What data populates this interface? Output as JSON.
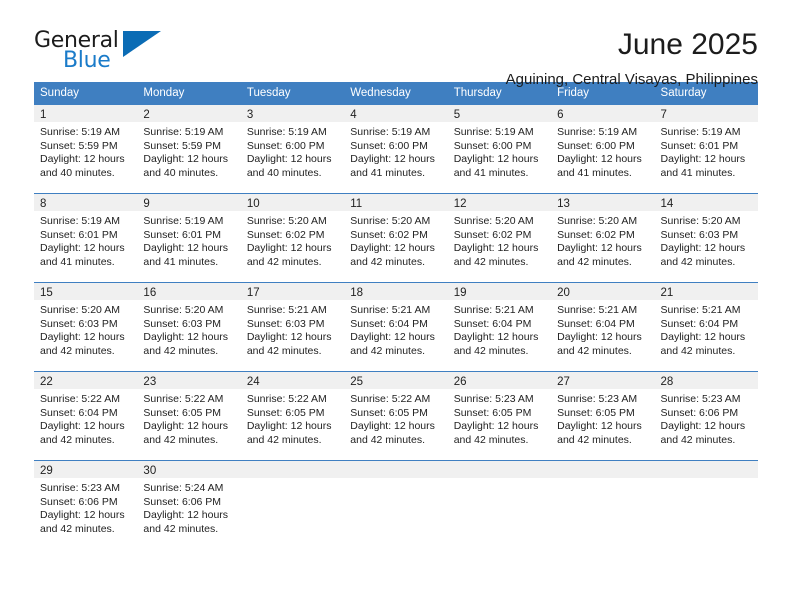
{
  "brand": {
    "name_part1": "General",
    "name_part2": "Blue",
    "logo_icon": "triangle-logo-icon"
  },
  "header": {
    "month_title": "June 2025",
    "location": "Aguining, Central Visayas, Philippines"
  },
  "theme": {
    "accent": "#3f7fc1",
    "brand_blue": "#1a7bc9",
    "daynum_band": "#f0f0f0",
    "text": "#222222"
  },
  "weekdays": [
    "Sunday",
    "Monday",
    "Tuesday",
    "Wednesday",
    "Thursday",
    "Friday",
    "Saturday"
  ],
  "weeks": [
    [
      {
        "day": "1",
        "sunrise": "Sunrise: 5:19 AM",
        "sunset": "Sunset: 5:59 PM",
        "daylight1": "Daylight: 12 hours",
        "daylight2": "and 40 minutes."
      },
      {
        "day": "2",
        "sunrise": "Sunrise: 5:19 AM",
        "sunset": "Sunset: 5:59 PM",
        "daylight1": "Daylight: 12 hours",
        "daylight2": "and 40 minutes."
      },
      {
        "day": "3",
        "sunrise": "Sunrise: 5:19 AM",
        "sunset": "Sunset: 6:00 PM",
        "daylight1": "Daylight: 12 hours",
        "daylight2": "and 40 minutes."
      },
      {
        "day": "4",
        "sunrise": "Sunrise: 5:19 AM",
        "sunset": "Sunset: 6:00 PM",
        "daylight1": "Daylight: 12 hours",
        "daylight2": "and 41 minutes."
      },
      {
        "day": "5",
        "sunrise": "Sunrise: 5:19 AM",
        "sunset": "Sunset: 6:00 PM",
        "daylight1": "Daylight: 12 hours",
        "daylight2": "and 41 minutes."
      },
      {
        "day": "6",
        "sunrise": "Sunrise: 5:19 AM",
        "sunset": "Sunset: 6:00 PM",
        "daylight1": "Daylight: 12 hours",
        "daylight2": "and 41 minutes."
      },
      {
        "day": "7",
        "sunrise": "Sunrise: 5:19 AM",
        "sunset": "Sunset: 6:01 PM",
        "daylight1": "Daylight: 12 hours",
        "daylight2": "and 41 minutes."
      }
    ],
    [
      {
        "day": "8",
        "sunrise": "Sunrise: 5:19 AM",
        "sunset": "Sunset: 6:01 PM",
        "daylight1": "Daylight: 12 hours",
        "daylight2": "and 41 minutes."
      },
      {
        "day": "9",
        "sunrise": "Sunrise: 5:19 AM",
        "sunset": "Sunset: 6:01 PM",
        "daylight1": "Daylight: 12 hours",
        "daylight2": "and 41 minutes."
      },
      {
        "day": "10",
        "sunrise": "Sunrise: 5:20 AM",
        "sunset": "Sunset: 6:02 PM",
        "daylight1": "Daylight: 12 hours",
        "daylight2": "and 42 minutes."
      },
      {
        "day": "11",
        "sunrise": "Sunrise: 5:20 AM",
        "sunset": "Sunset: 6:02 PM",
        "daylight1": "Daylight: 12 hours",
        "daylight2": "and 42 minutes."
      },
      {
        "day": "12",
        "sunrise": "Sunrise: 5:20 AM",
        "sunset": "Sunset: 6:02 PM",
        "daylight1": "Daylight: 12 hours",
        "daylight2": "and 42 minutes."
      },
      {
        "day": "13",
        "sunrise": "Sunrise: 5:20 AM",
        "sunset": "Sunset: 6:02 PM",
        "daylight1": "Daylight: 12 hours",
        "daylight2": "and 42 minutes."
      },
      {
        "day": "14",
        "sunrise": "Sunrise: 5:20 AM",
        "sunset": "Sunset: 6:03 PM",
        "daylight1": "Daylight: 12 hours",
        "daylight2": "and 42 minutes."
      }
    ],
    [
      {
        "day": "15",
        "sunrise": "Sunrise: 5:20 AM",
        "sunset": "Sunset: 6:03 PM",
        "daylight1": "Daylight: 12 hours",
        "daylight2": "and 42 minutes."
      },
      {
        "day": "16",
        "sunrise": "Sunrise: 5:20 AM",
        "sunset": "Sunset: 6:03 PM",
        "daylight1": "Daylight: 12 hours",
        "daylight2": "and 42 minutes."
      },
      {
        "day": "17",
        "sunrise": "Sunrise: 5:21 AM",
        "sunset": "Sunset: 6:03 PM",
        "daylight1": "Daylight: 12 hours",
        "daylight2": "and 42 minutes."
      },
      {
        "day": "18",
        "sunrise": "Sunrise: 5:21 AM",
        "sunset": "Sunset: 6:04 PM",
        "daylight1": "Daylight: 12 hours",
        "daylight2": "and 42 minutes."
      },
      {
        "day": "19",
        "sunrise": "Sunrise: 5:21 AM",
        "sunset": "Sunset: 6:04 PM",
        "daylight1": "Daylight: 12 hours",
        "daylight2": "and 42 minutes."
      },
      {
        "day": "20",
        "sunrise": "Sunrise: 5:21 AM",
        "sunset": "Sunset: 6:04 PM",
        "daylight1": "Daylight: 12 hours",
        "daylight2": "and 42 minutes."
      },
      {
        "day": "21",
        "sunrise": "Sunrise: 5:21 AM",
        "sunset": "Sunset: 6:04 PM",
        "daylight1": "Daylight: 12 hours",
        "daylight2": "and 42 minutes."
      }
    ],
    [
      {
        "day": "22",
        "sunrise": "Sunrise: 5:22 AM",
        "sunset": "Sunset: 6:04 PM",
        "daylight1": "Daylight: 12 hours",
        "daylight2": "and 42 minutes."
      },
      {
        "day": "23",
        "sunrise": "Sunrise: 5:22 AM",
        "sunset": "Sunset: 6:05 PM",
        "daylight1": "Daylight: 12 hours",
        "daylight2": "and 42 minutes."
      },
      {
        "day": "24",
        "sunrise": "Sunrise: 5:22 AM",
        "sunset": "Sunset: 6:05 PM",
        "daylight1": "Daylight: 12 hours",
        "daylight2": "and 42 minutes."
      },
      {
        "day": "25",
        "sunrise": "Sunrise: 5:22 AM",
        "sunset": "Sunset: 6:05 PM",
        "daylight1": "Daylight: 12 hours",
        "daylight2": "and 42 minutes."
      },
      {
        "day": "26",
        "sunrise": "Sunrise: 5:23 AM",
        "sunset": "Sunset: 6:05 PM",
        "daylight1": "Daylight: 12 hours",
        "daylight2": "and 42 minutes."
      },
      {
        "day": "27",
        "sunrise": "Sunrise: 5:23 AM",
        "sunset": "Sunset: 6:05 PM",
        "daylight1": "Daylight: 12 hours",
        "daylight2": "and 42 minutes."
      },
      {
        "day": "28",
        "sunrise": "Sunrise: 5:23 AM",
        "sunset": "Sunset: 6:06 PM",
        "daylight1": "Daylight: 12 hours",
        "daylight2": "and 42 minutes."
      }
    ],
    [
      {
        "day": "29",
        "sunrise": "Sunrise: 5:23 AM",
        "sunset": "Sunset: 6:06 PM",
        "daylight1": "Daylight: 12 hours",
        "daylight2": "and 42 minutes."
      },
      {
        "day": "30",
        "sunrise": "Sunrise: 5:24 AM",
        "sunset": "Sunset: 6:06 PM",
        "daylight1": "Daylight: 12 hours",
        "daylight2": "and 42 minutes."
      },
      {
        "day": "",
        "sunrise": "",
        "sunset": "",
        "daylight1": "",
        "daylight2": ""
      },
      {
        "day": "",
        "sunrise": "",
        "sunset": "",
        "daylight1": "",
        "daylight2": ""
      },
      {
        "day": "",
        "sunrise": "",
        "sunset": "",
        "daylight1": "",
        "daylight2": ""
      },
      {
        "day": "",
        "sunrise": "",
        "sunset": "",
        "daylight1": "",
        "daylight2": ""
      },
      {
        "day": "",
        "sunrise": "",
        "sunset": "",
        "daylight1": "",
        "daylight2": ""
      }
    ]
  ]
}
